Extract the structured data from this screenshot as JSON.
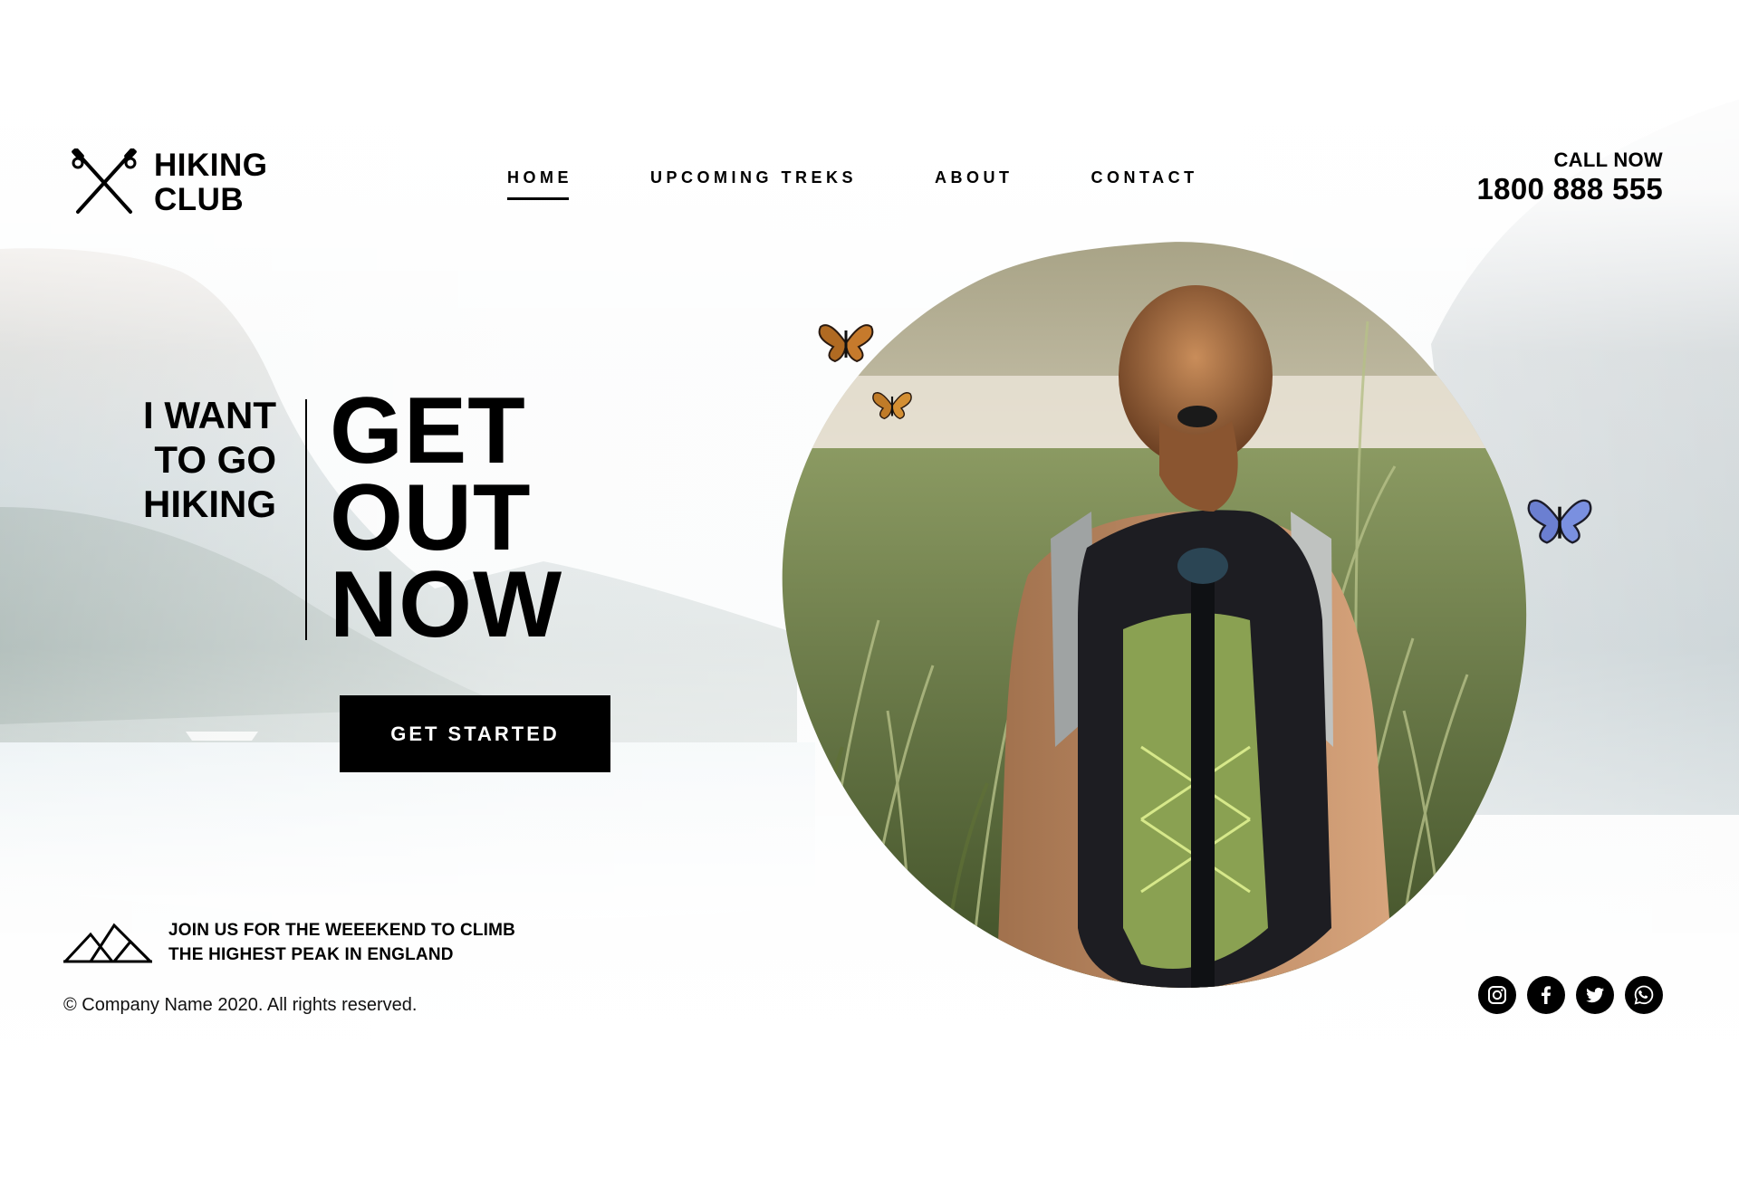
{
  "header": {
    "logo": {
      "line1": "HIKING",
      "line2": "CLUB",
      "icon": "crossed-trekking-poles-icon"
    },
    "nav": [
      {
        "label": "HOME",
        "active": true
      },
      {
        "label": "UPCOMING TREKS",
        "active": false
      },
      {
        "label": "ABOUT",
        "active": false
      },
      {
        "label": "CONTACT",
        "active": false
      }
    ],
    "call": {
      "label": "CALL NOW",
      "number": "1800 888 555"
    }
  },
  "hero": {
    "small_lines": [
      "I WANT",
      "TO GO",
      "HIKING"
    ],
    "big_lines": [
      "GET",
      "OUT",
      "NOW"
    ],
    "cta_label": "GET STARTED"
  },
  "promo": {
    "icon": "mountains-icon",
    "lines": [
      "JOIN US FOR THE WEEEKEND TO CLIMB",
      "THE HIGHEST PEAK IN ENGLAND"
    ]
  },
  "footer": {
    "copyright": "© Company Name 2020. All rights reserved."
  },
  "social": [
    {
      "name": "instagram-icon"
    },
    {
      "name": "facebook-icon"
    },
    {
      "name": "twitter-icon"
    },
    {
      "name": "whatsapp-icon"
    }
  ],
  "colors": {
    "text": "#000000",
    "button_bg": "#000000",
    "button_text": "#ffffff",
    "background": "#ffffff"
  }
}
